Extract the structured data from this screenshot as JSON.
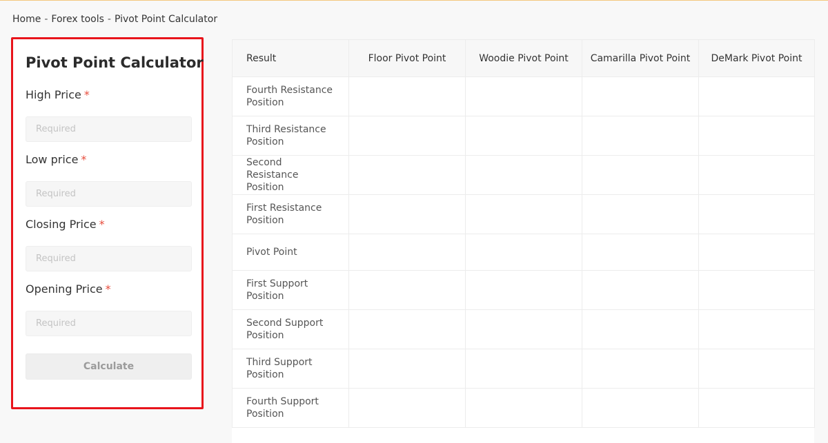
{
  "breadcrumb": {
    "home": "Home",
    "separator": "-",
    "section": "Forex tools",
    "current": "Pivot Point Calculator"
  },
  "form": {
    "title": "Pivot Point Calculator",
    "required_mark": "*",
    "fields": [
      {
        "label": "High Price",
        "placeholder": "Required",
        "value": ""
      },
      {
        "label": "Low price",
        "placeholder": "Required",
        "value": ""
      },
      {
        "label": "Closing Price",
        "placeholder": "Required",
        "value": ""
      },
      {
        "label": "Opening Price",
        "placeholder": "Required",
        "value": ""
      }
    ],
    "submit_label": "Calculate"
  },
  "results": {
    "columns": [
      "Result",
      "Floor Pivot Point",
      "Woodie Pivot Point",
      "Camarilla Pivot Point",
      "DeMark Pivot Point"
    ],
    "rows": [
      {
        "label": "Fourth Resistance Position",
        "values": [
          "",
          "",
          "",
          ""
        ]
      },
      {
        "label": "Third Resistance Position",
        "values": [
          "",
          "",
          "",
          ""
        ]
      },
      {
        "label": "Second Resistance Position",
        "values": [
          "",
          "",
          "",
          ""
        ]
      },
      {
        "label": "First Resistance Position",
        "values": [
          "",
          "",
          "",
          ""
        ]
      },
      {
        "label": "Pivot Point",
        "values": [
          "",
          "",
          "",
          ""
        ]
      },
      {
        "label": "First Support Position",
        "values": [
          "",
          "",
          "",
          ""
        ]
      },
      {
        "label": "Second Support Position",
        "values": [
          "",
          "",
          "",
          ""
        ]
      },
      {
        "label": "Third Support Position",
        "values": [
          "",
          "",
          "",
          ""
        ]
      },
      {
        "label": "Fourth Support Position",
        "values": [
          "",
          "",
          "",
          ""
        ]
      }
    ]
  },
  "colors": {
    "highlight_border": "#e8141b",
    "required_mark": "#e74c3c",
    "top_accent": "#f3c77e"
  }
}
